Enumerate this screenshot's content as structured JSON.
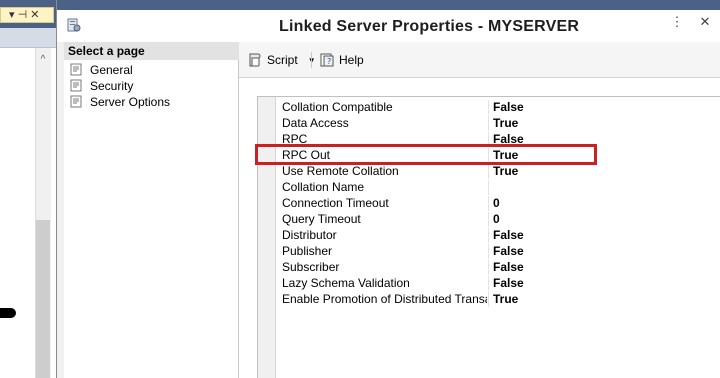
{
  "dialog": {
    "title": "Linked Server Properties - MYSERVER",
    "controls": {
      "more": "⋮",
      "close": "✕"
    }
  },
  "background_window": {
    "tab_glyphs": "▾ ⊣ ✕",
    "scroll_up": "^"
  },
  "nav": {
    "header": "Select a page",
    "items": [
      {
        "label": "General",
        "icon": "page-icon"
      },
      {
        "label": "Security",
        "icon": "page-icon"
      },
      {
        "label": "Server Options",
        "icon": "page-icon"
      }
    ]
  },
  "toolbar": {
    "script_label": "Script",
    "help_label": "Help"
  },
  "properties": [
    {
      "name": "Collation Compatible",
      "value": "False"
    },
    {
      "name": "Data Access",
      "value": "True"
    },
    {
      "name": "RPC",
      "value": "False"
    },
    {
      "name": "RPC Out",
      "value": "True"
    },
    {
      "name": "Use Remote Collation",
      "value": "True"
    },
    {
      "name": "Collation Name",
      "value": ""
    },
    {
      "name": "Connection Timeout",
      "value": "0"
    },
    {
      "name": "Query Timeout",
      "value": "0"
    },
    {
      "name": "Distributor",
      "value": "False"
    },
    {
      "name": "Publisher",
      "value": "False"
    },
    {
      "name": "Subscriber",
      "value": "False"
    },
    {
      "name": "Lazy Schema Validation",
      "value": "False"
    },
    {
      "name": "Enable Promotion of Distributed Transactions",
      "value": "True"
    }
  ],
  "colors": {
    "highlight": "#cc1f1f",
    "titlebar": "#4c6186"
  }
}
